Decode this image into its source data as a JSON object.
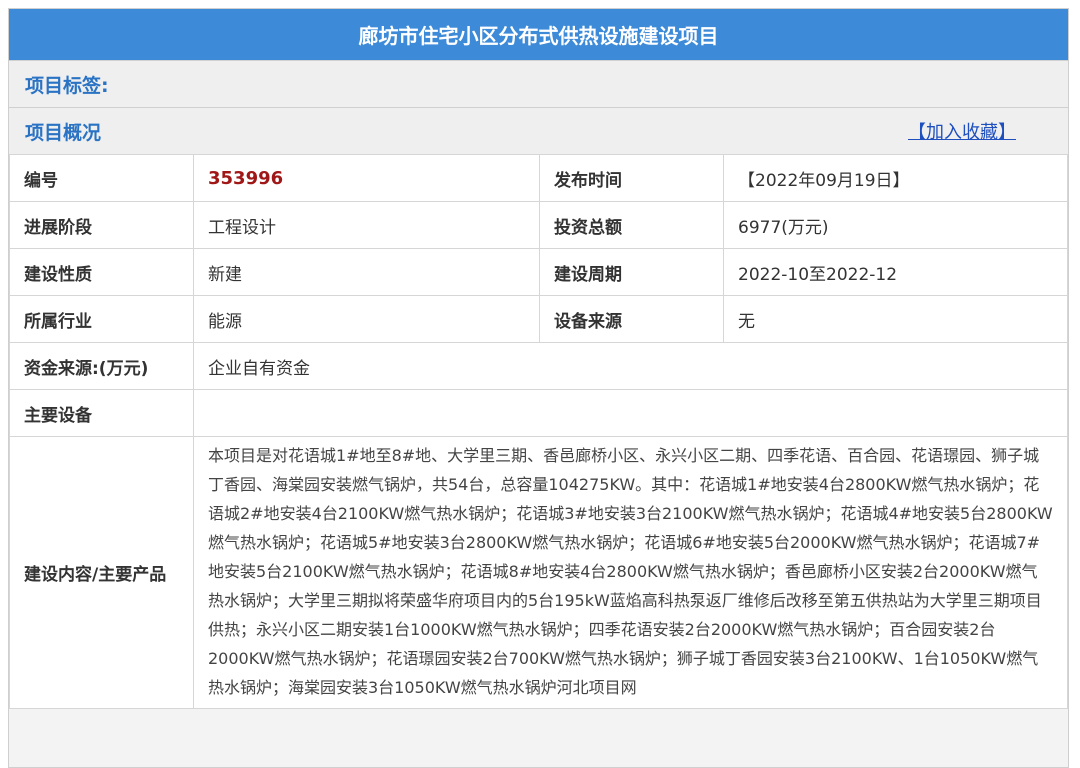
{
  "title": "廊坊市住宅小区分布式供热设施建设项目",
  "tag_label": "项目标签:",
  "overview_label": "项目概况",
  "favorite_link": "【加入收藏】",
  "info": {
    "number_label": "编号",
    "number_value": "353996",
    "publish_label": "发布时间",
    "publish_value": "【2022年09月19日】",
    "stage_label": "进展阶段",
    "stage_value": "工程设计",
    "investment_label": "投资总额",
    "investment_value": "6977(万元)",
    "nature_label": "建设性质",
    "nature_value": "新建",
    "period_label": "建设周期",
    "period_value": "2022-10至2022-12",
    "industry_label": "所属行业",
    "industry_value": "能源",
    "equipment_source_label": "设备来源",
    "equipment_source_value": "无",
    "fund_label": "资金来源:(万元)",
    "fund_value": "企业自有资金",
    "main_equipment_label": "主要设备",
    "main_equipment_value": "",
    "content_label": "建设内容/主要产品",
    "content_value": "本项目是对花语城1#地至8#地、大学里三期、香邑廊桥小区、永兴小区二期、四季花语、百合园、花语璟园、狮子城丁香园、海棠园安装燃气锅炉，共54台，总容量104275KW。其中：花语城1#地安装4台2800KW燃气热水锅炉；花语城2#地安装4台2100KW燃气热水锅炉；花语城3#地安装3台2100KW燃气热水锅炉；花语城4#地安装5台2800KW燃气热水锅炉；花语城5#地安装3台2800KW燃气热水锅炉；花语城6#地安装5台2000KW燃气热水锅炉；花语城7#地安装5台2100KW燃气热水锅炉；花语城8#地安装4台2800KW燃气热水锅炉；香邑廊桥小区安装2台2000KW燃气热水锅炉；大学里三期拟将荣盛华府项目内的5台195kW蓝焰高科热泵返厂维修后改移至第五供热站为大学里三期项目供热；永兴小区二期安装1台1000KW燃气热水锅炉；四季花语安装2台2000KW燃气热水锅炉；百合园安装2台2000KW燃气热水锅炉；花语璟园安装2台700KW燃气热水锅炉；狮子城丁香园安装3台2100KW、1台1050KW燃气热水锅炉；海棠园安装3台1050KW燃气热水锅炉河北项目网"
  }
}
